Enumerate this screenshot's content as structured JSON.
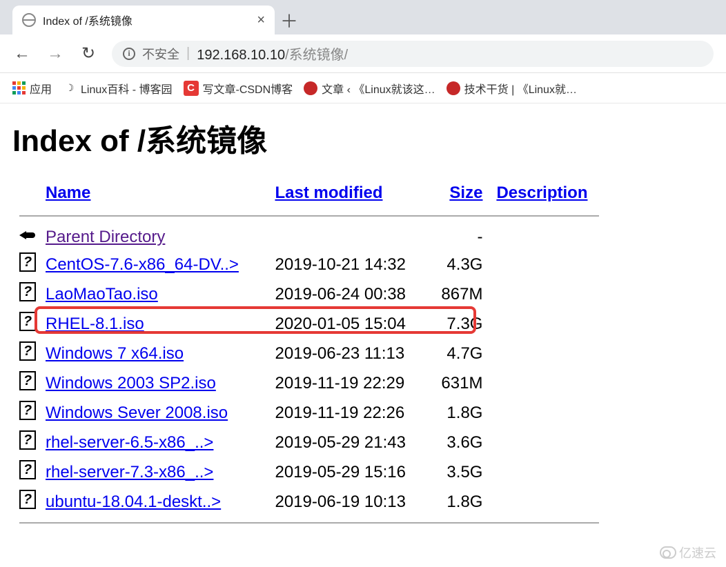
{
  "tab": {
    "title": "Index of /系统镜像"
  },
  "address": {
    "not_secure": "不安全",
    "host": "192.168.10.10",
    "path": "/系统镜像/"
  },
  "bookmarks": {
    "apps": "应用",
    "items": [
      {
        "label": "Linux百科 - 博客园",
        "icon": "gear"
      },
      {
        "label": "写文章-CSDN博客",
        "icon": "c"
      },
      {
        "label": "文章 ‹ 《Linux就该这…",
        "icon": "red"
      },
      {
        "label": "技术干货 | 《Linux就…",
        "icon": "red"
      }
    ]
  },
  "page": {
    "heading": "Index of /系统镜像",
    "columns": {
      "name": "Name",
      "modified": "Last modified",
      "size": "Size",
      "desc": "Description"
    },
    "parent": {
      "label": "Parent Directory",
      "size": "-"
    },
    "files": [
      {
        "name": "CentOS-7.6-x86_64-DV..>",
        "modified": "2019-10-21 14:32",
        "size": "4.3G",
        "highlight": false
      },
      {
        "name": "LaoMaoTao.iso",
        "modified": "2019-06-24 00:38",
        "size": "867M",
        "highlight": false
      },
      {
        "name": "RHEL-8.1.iso",
        "modified": "2020-01-05 15:04",
        "size": "7.3G",
        "highlight": true
      },
      {
        "name": "Windows 7 x64.iso",
        "modified": "2019-06-23 11:13",
        "size": "4.7G",
        "highlight": false
      },
      {
        "name": "Windows 2003 SP2.iso",
        "modified": "2019-11-19 22:29",
        "size": "631M",
        "highlight": false
      },
      {
        "name": "Windows Sever 2008.iso",
        "modified": "2019-11-19 22:26",
        "size": "1.8G",
        "highlight": false
      },
      {
        "name": "rhel-server-6.5-x86_..>",
        "modified": "2019-05-29 21:43",
        "size": "3.6G",
        "highlight": false
      },
      {
        "name": "rhel-server-7.3-x86_..>",
        "modified": "2019-05-29 15:16",
        "size": "3.5G",
        "highlight": false
      },
      {
        "name": "ubuntu-18.04.1-deskt..>",
        "modified": "2019-06-19 10:13",
        "size": "1.8G",
        "highlight": false
      }
    ]
  },
  "watermark": "亿速云"
}
